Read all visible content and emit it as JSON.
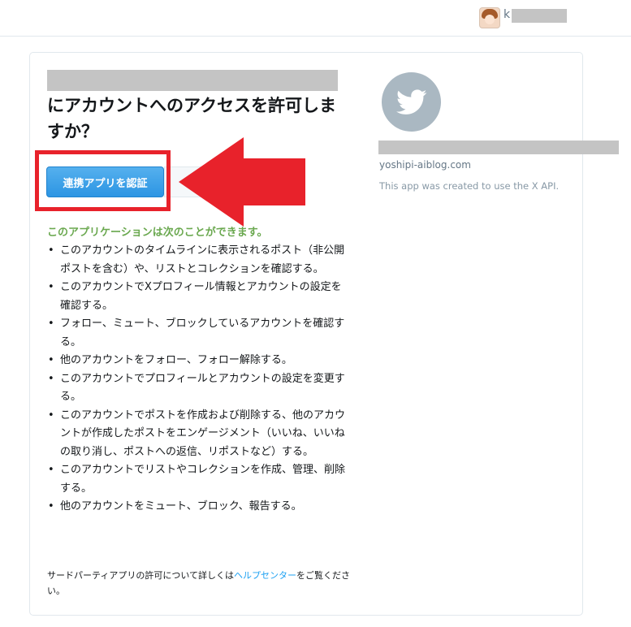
{
  "header": {
    "user_initial": "k"
  },
  "auth": {
    "heading": "にアカウントへのアクセスを許可しますか？",
    "authorize_label": "連携アプリを認証",
    "capabilities_heading": "このアプリケーションは次のことができます。",
    "permissions": [
      "このアカウントのタイムラインに表示されるポスト（非公開ポストを含む）や、リストとコレクションを確認する。",
      "このアカウントでXプロフィール情報とアカウントの設定を確認する。",
      "フォロー、ミュート、ブロックしているアカウントを確認する。",
      "他のアカウントをフォロー、フォロー解除する。",
      "このアカウントでプロフィールとアカウントの設定を変更する。",
      "このアカウントでポストを作成および削除する、他のアカウントが作成したポストをエンゲージメント（いいね、いいねの取り消し、ポストへの返信、リポストなど）する。",
      "このアカウントでリストやコレクションを作成、管理、削除する。",
      "他のアカウントをミュート、ブロック、報告する。"
    ],
    "footer_before": "サードパーティアプリの許可について詳しくは",
    "footer_link": "ヘルプセンター",
    "footer_after": "をご覧ください。"
  },
  "app": {
    "logo_icon": "twitter-bird-icon",
    "url": "yoshipi-aiblog.com",
    "description": "This app was created to use the X API."
  },
  "annotation": {
    "box_color": "#e8222b",
    "arrow_color": "#e8222b"
  },
  "colors": {
    "primary_button": "#2c95e3",
    "capabilities_heading": "#6aa84f",
    "link": "#1da1f2",
    "logo_bg": "#aab8c2"
  }
}
